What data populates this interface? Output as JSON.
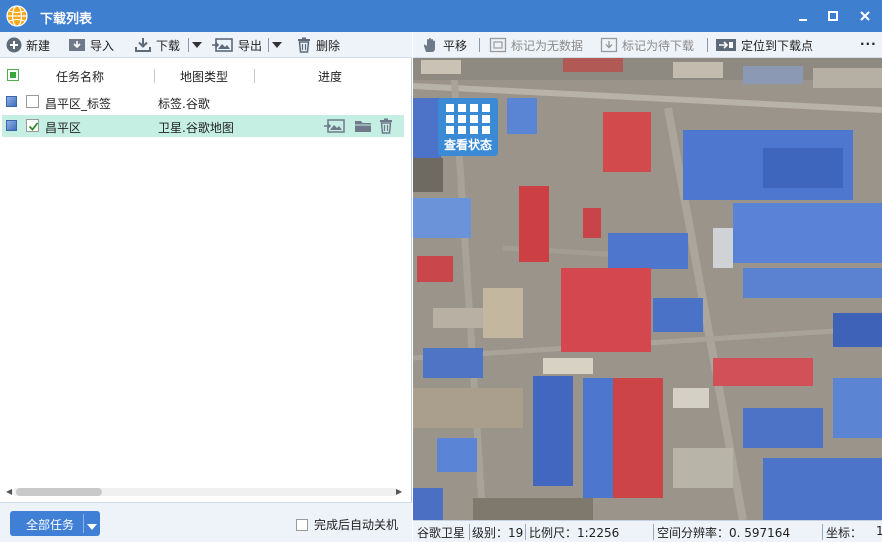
{
  "window": {
    "title": "下载列表",
    "icon": "globe-icon",
    "controls": [
      "minimize-icon",
      "maximize-icon",
      "close-icon"
    ]
  },
  "toolbar": {
    "new_label": "新建",
    "import_label": "导入",
    "download_label": "下载",
    "export_label": "导出",
    "delete_label": "删除"
  },
  "grid": {
    "columns": [
      "任务名称",
      "地图类型",
      "进度"
    ],
    "rows": [
      {
        "name": "昌平区_标签",
        "type": "标签.谷歌",
        "checked": false,
        "selected": false
      },
      {
        "name": "昌平区",
        "type": "卫星.谷歌地图",
        "checked": true,
        "selected": true
      }
    ],
    "row_icons": [
      "export-image-icon",
      "folder-icon",
      "trash-icon"
    ]
  },
  "bottom": {
    "all_tasks_label": "全部任务",
    "auto_shutdown_label": "完成后自动关机"
  },
  "map_toolbar": {
    "pan_label": "平移",
    "mark_no_data_label": "标记为无数据",
    "mark_pending_label": "标记为待下载",
    "locate_label": "定位到下载点",
    "more_label": "···"
  },
  "map": {
    "view_status_label": "查看状态",
    "imagery": "satellite view of an industrial district with blue and red roofed buildings"
  },
  "statusbar": {
    "source": "谷歌卫星",
    "level": "级别：19",
    "scale": "比例尺：1:2256",
    "resolution": "空间分辨率：0. 597164",
    "coords": "坐标：",
    "coords_value": "1"
  },
  "colors": {
    "titlebar": "#3f7fcf",
    "accent": "#3f7fd6",
    "selected_row": "#c6efe3"
  }
}
